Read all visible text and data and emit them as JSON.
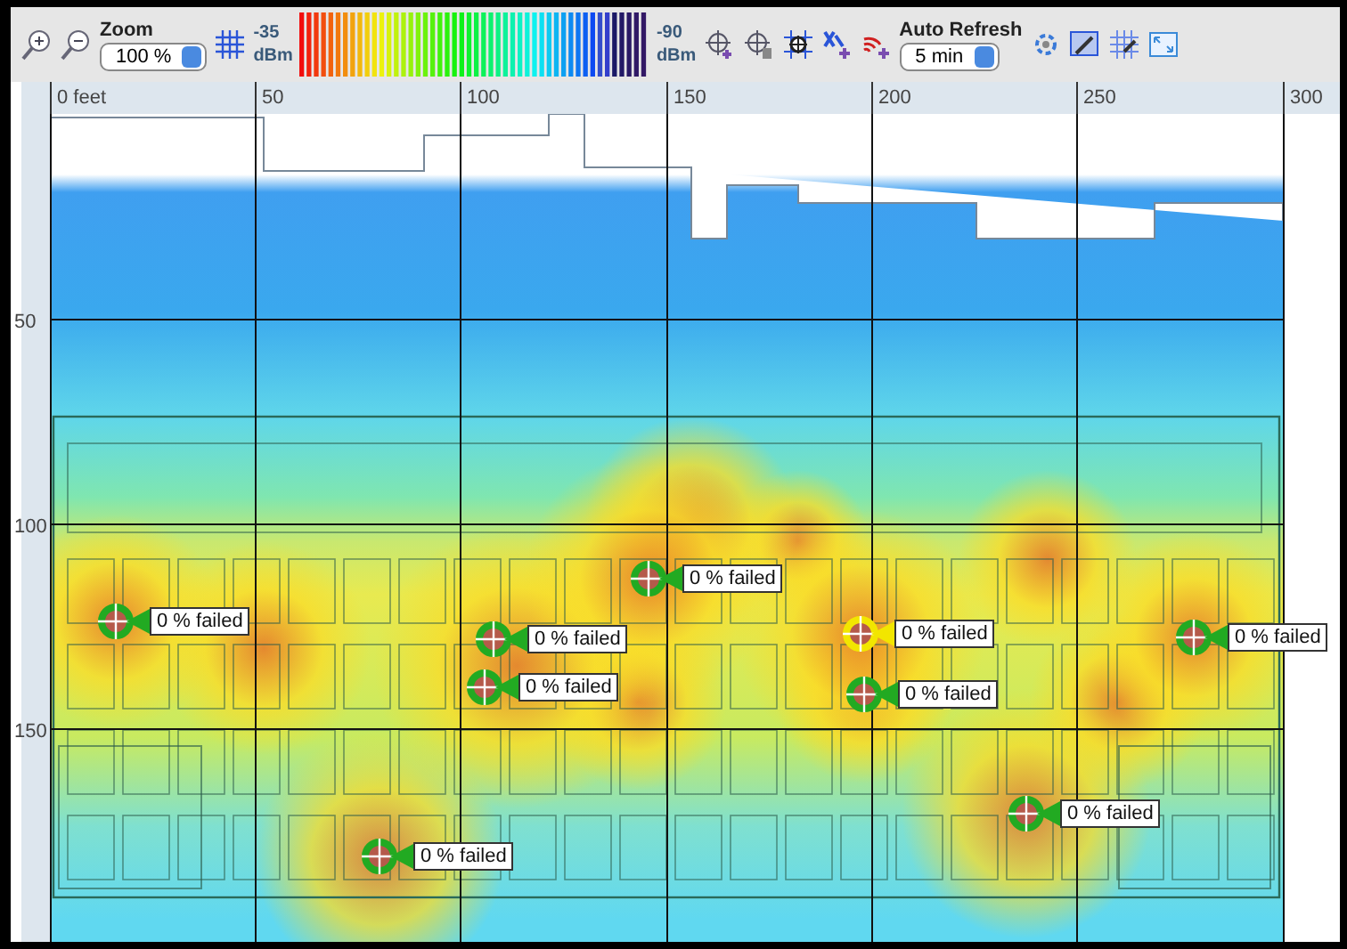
{
  "toolbar": {
    "zoom_label": "Zoom",
    "zoom_value": "100 %",
    "scale_max": "-35",
    "scale_max_unit": "dBm",
    "scale_min": "-90",
    "scale_min_unit": "dBm",
    "refresh_label": "Auto Refresh",
    "refresh_value": "5 min"
  },
  "ruler": {
    "x_labels": [
      "0 feet",
      "50",
      "100",
      "150",
      "200",
      "250",
      "300"
    ],
    "y_labels": [
      "50",
      "100",
      "150"
    ]
  },
  "markers": [
    {
      "label": "0 % failed",
      "color": "#22aa22"
    },
    {
      "label": "0 % failed",
      "color": "#22aa22"
    },
    {
      "label": "0 % failed",
      "color": "#22aa22"
    },
    {
      "label": "0 % failed",
      "color": "#f2e600"
    },
    {
      "label": "0 % failed",
      "color": "#22aa22"
    },
    {
      "label": "0 % failed",
      "color": "#22aa22"
    },
    {
      "label": "0 % failed",
      "color": "#22aa22"
    },
    {
      "label": "0 % failed",
      "color": "#22aa22"
    },
    {
      "label": "0 % failed",
      "color": "#22aa22"
    }
  ]
}
